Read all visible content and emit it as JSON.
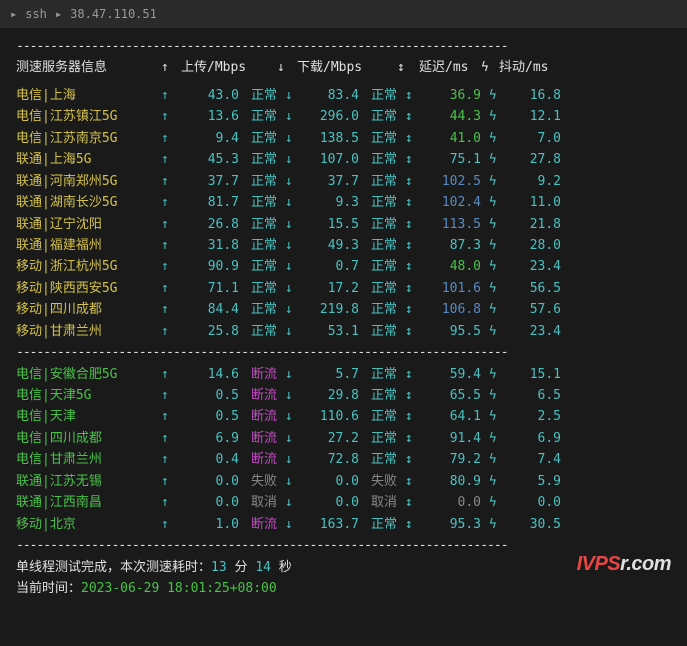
{
  "titlebar": {
    "prompt": "▸",
    "ssh": "ssh",
    "sep": "▸",
    "ip": "38.47.110.51"
  },
  "divider": "------------------------------------------------------------------------",
  "headers": {
    "server": "测速服务器信息",
    "upload": "上传/Mbps",
    "download": "下载/Mbps",
    "latency": "延迟/ms",
    "jitter": "抖动/ms",
    "a1": "↑",
    "a2": "↓",
    "a3": "↕",
    "a4": "ϟ"
  },
  "rows1": [
    {
      "srv": "电信|上海",
      "sc": "c-yellow",
      "up": "43.0",
      "us": "正常",
      "usC": "c-cyan",
      "dn": "83.4",
      "ds": "正常",
      "dsC": "c-cyan",
      "lat": "36.9",
      "latC": "c-green",
      "jit": "16.8"
    },
    {
      "srv": "电信|江苏镇江5G",
      "sc": "c-yellow",
      "up": "13.6",
      "us": "正常",
      "usC": "c-cyan",
      "dn": "296.0",
      "ds": "正常",
      "dsC": "c-cyan",
      "lat": "44.3",
      "latC": "c-green",
      "jit": "12.1"
    },
    {
      "srv": "电信|江苏南京5G",
      "sc": "c-yellow",
      "up": "9.4",
      "us": "正常",
      "usC": "c-cyan",
      "dn": "138.5",
      "ds": "正常",
      "dsC": "c-cyan",
      "lat": "41.0",
      "latC": "c-green",
      "jit": "7.0"
    },
    {
      "srv": "联通|上海5G",
      "sc": "c-yellow",
      "up": "45.3",
      "us": "正常",
      "usC": "c-cyan",
      "dn": "107.0",
      "ds": "正常",
      "dsC": "c-cyan",
      "lat": "75.1",
      "latC": "c-cyan",
      "jit": "27.8"
    },
    {
      "srv": "联通|河南郑州5G",
      "sc": "c-yellow",
      "up": "37.7",
      "us": "正常",
      "usC": "c-cyan",
      "dn": "37.7",
      "ds": "正常",
      "dsC": "c-cyan",
      "lat": "102.5",
      "latC": "c-blue",
      "jit": "9.2"
    },
    {
      "srv": "联通|湖南长沙5G",
      "sc": "c-yellow",
      "up": "81.7",
      "us": "正常",
      "usC": "c-cyan",
      "dn": "9.3",
      "ds": "正常",
      "dsC": "c-cyan",
      "lat": "102.4",
      "latC": "c-blue",
      "jit": "11.0"
    },
    {
      "srv": "联通|辽宁沈阳",
      "sc": "c-yellow",
      "up": "26.8",
      "us": "正常",
      "usC": "c-cyan",
      "dn": "15.5",
      "ds": "正常",
      "dsC": "c-cyan",
      "lat": "113.5",
      "latC": "c-blue",
      "jit": "21.8"
    },
    {
      "srv": "联通|福建福州",
      "sc": "c-yellow",
      "up": "31.8",
      "us": "正常",
      "usC": "c-cyan",
      "dn": "49.3",
      "ds": "正常",
      "dsC": "c-cyan",
      "lat": "87.3",
      "latC": "c-cyan",
      "jit": "28.0"
    },
    {
      "srv": "移动|浙江杭州5G",
      "sc": "c-yellow",
      "up": "90.9",
      "us": "正常",
      "usC": "c-cyan",
      "dn": "0.7",
      "ds": "正常",
      "dsC": "c-cyan",
      "lat": "48.0",
      "latC": "c-green",
      "jit": "23.4"
    },
    {
      "srv": "移动|陕西西安5G",
      "sc": "c-yellow",
      "up": "71.1",
      "us": "正常",
      "usC": "c-cyan",
      "dn": "17.2",
      "ds": "正常",
      "dsC": "c-cyan",
      "lat": "101.6",
      "latC": "c-blue",
      "jit": "56.5"
    },
    {
      "srv": "移动|四川成都",
      "sc": "c-yellow",
      "up": "84.4",
      "us": "正常",
      "usC": "c-cyan",
      "dn": "219.8",
      "ds": "正常",
      "dsC": "c-cyan",
      "lat": "106.8",
      "latC": "c-blue",
      "jit": "57.6"
    },
    {
      "srv": "移动|甘肃兰州",
      "sc": "c-yellow",
      "up": "25.8",
      "us": "正常",
      "usC": "c-cyan",
      "dn": "53.1",
      "ds": "正常",
      "dsC": "c-cyan",
      "lat": "95.5",
      "latC": "c-cyan",
      "jit": "23.4"
    }
  ],
  "rows2": [
    {
      "srv": "电信|安徽合肥5G",
      "sc": "c-green",
      "up": "14.6",
      "us": "断流",
      "usC": "c-magenta",
      "dn": "5.7",
      "ds": "正常",
      "dsC": "c-cyan",
      "lat": "59.4",
      "latC": "c-cyan",
      "jit": "15.1"
    },
    {
      "srv": "电信|天津5G",
      "sc": "c-green",
      "up": "0.5",
      "us": "断流",
      "usC": "c-magenta",
      "dn": "29.8",
      "ds": "正常",
      "dsC": "c-cyan",
      "lat": "65.5",
      "latC": "c-cyan",
      "jit": "6.5"
    },
    {
      "srv": "电信|天津",
      "sc": "c-green",
      "up": "0.5",
      "us": "断流",
      "usC": "c-magenta",
      "dn": "110.6",
      "ds": "正常",
      "dsC": "c-cyan",
      "lat": "64.1",
      "latC": "c-cyan",
      "jit": "2.5"
    },
    {
      "srv": "电信|四川成都",
      "sc": "c-green",
      "up": "6.9",
      "us": "断流",
      "usC": "c-magenta",
      "dn": "27.2",
      "ds": "正常",
      "dsC": "c-cyan",
      "lat": "91.4",
      "latC": "c-cyan",
      "jit": "6.9"
    },
    {
      "srv": "电信|甘肃兰州",
      "sc": "c-green",
      "up": "0.4",
      "us": "断流",
      "usC": "c-magenta",
      "dn": "72.8",
      "ds": "正常",
      "dsC": "c-cyan",
      "lat": "79.2",
      "latC": "c-cyan",
      "jit": "7.4"
    },
    {
      "srv": "联通|江苏无锡",
      "sc": "c-green",
      "up": "0.0",
      "us": "失败",
      "usC": "c-gray",
      "dn": "0.0",
      "ds": "失败",
      "dsC": "c-gray",
      "lat": "80.9",
      "latC": "c-cyan",
      "jit": "5.9"
    },
    {
      "srv": "联通|江西南昌",
      "sc": "c-green",
      "up": "0.0",
      "us": "取消",
      "usC": "c-gray",
      "dn": "0.0",
      "ds": "取消",
      "dsC": "c-gray",
      "lat": "0.0",
      "latC": "c-gray",
      "jit": "0.0"
    },
    {
      "srv": "移动|北京",
      "sc": "c-green",
      "up": "1.0",
      "us": "断流",
      "usC": "c-magenta",
      "dn": "163.7",
      "ds": "正常",
      "dsC": "c-cyan",
      "lat": "95.3",
      "latC": "c-cyan",
      "jit": "30.5"
    }
  ],
  "footer": {
    "l1a": "单线程测试完成，本次测速耗时：",
    "l1b": "13",
    "l1c": " 分 ",
    "l1d": "14",
    "l1e": " 秒",
    "l2a": "当前时间：",
    "l2b": "2023-06-29 18:01:25+08:00"
  },
  "watermark": {
    "p1": "IVPS",
    "p2": "r.com"
  }
}
